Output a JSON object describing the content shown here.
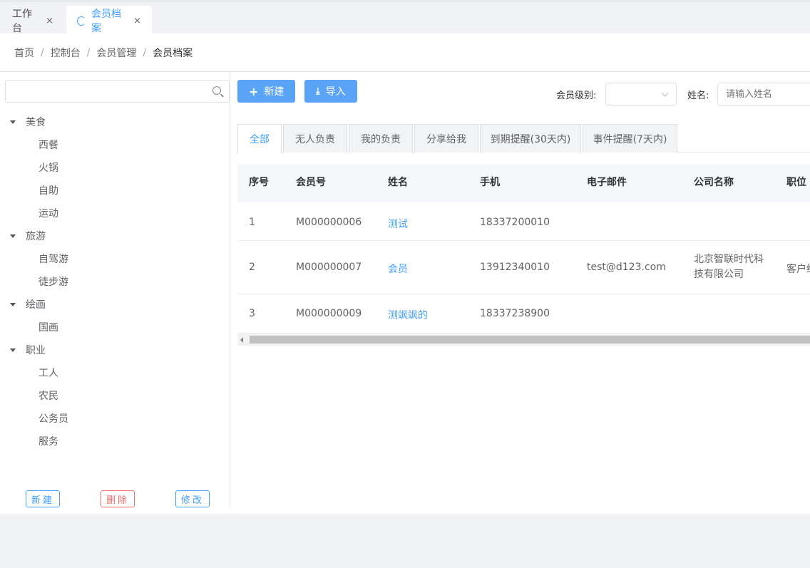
{
  "tabs": [
    {
      "label": "工作台",
      "close": "×"
    },
    {
      "label": "会员档案",
      "close": "×"
    }
  ],
  "breadcrumb": [
    "首页",
    "控制台",
    "会员管理",
    "会员档案"
  ],
  "breadcrumb_sep": "/",
  "tree": {
    "search_placeholder": "",
    "groups": [
      {
        "label": "美食",
        "children": [
          "西餐",
          "火锅",
          "自助",
          "运动"
        ]
      },
      {
        "label": "旅游",
        "children": [
          "自驾游",
          "徒步游"
        ]
      },
      {
        "label": "绘画",
        "children": [
          "国画"
        ]
      },
      {
        "label": "职业",
        "children": [
          "工人",
          "农民",
          "公务员",
          "服务"
        ]
      }
    ],
    "actions": {
      "create": "新建",
      "delete": "删除",
      "edit": "修改"
    }
  },
  "toolbar": {
    "new_label": "新建",
    "import_label": "导入",
    "level_label": "会员级别:",
    "level_value": "",
    "name_label": "姓名:",
    "name_placeholder": "请输入姓名"
  },
  "filter_tabs": [
    "全部",
    "无人负责",
    "我的负责",
    "分享给我",
    "到期提醒(30天内)",
    "事件提醒(7天内)"
  ],
  "table": {
    "columns": [
      "序号",
      "会员号",
      "姓名",
      "手机",
      "电子邮件",
      "公司名称",
      "职位"
    ],
    "rows": [
      {
        "index": "1",
        "member_no": "M000000006",
        "name": "测试",
        "phone": "18337200010",
        "email": "",
        "company": "",
        "position": ""
      },
      {
        "index": "2",
        "member_no": "M000000007",
        "name": "会员",
        "phone": "13912340010",
        "email": "test@d123.com",
        "company": "北京智联时代科技有限公司",
        "position": "客户经理"
      },
      {
        "index": "3",
        "member_no": "M000000009",
        "name": "测飒飒的",
        "phone": "18337238900",
        "email": "",
        "company": "",
        "position": ""
      }
    ]
  },
  "colors": {
    "primary": "#409eff",
    "danger": "#f56c6c"
  }
}
